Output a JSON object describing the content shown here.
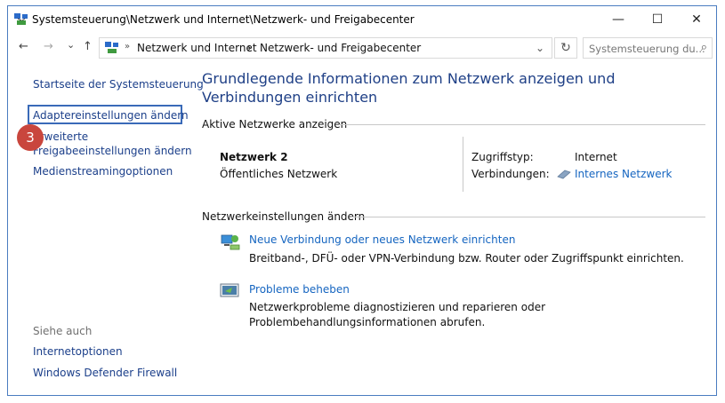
{
  "window": {
    "title": "Systemsteuerung\\Netzwerk und Internet\\Netzwerk- und Freigabecenter",
    "minimize": "—",
    "maximize": "☐",
    "close": "✕"
  },
  "address": {
    "back": "←",
    "forward": "→",
    "recent": "⌄",
    "up": "↑",
    "crumb_sep": "»",
    "crumbs": [
      "Netzwerk und Internet",
      "Netzwerk- und Freigabecenter"
    ],
    "crumb_arrow": "›",
    "dropdown": "⌄",
    "refresh": "↻",
    "search_placeholder": "Systemsteuerung du...",
    "search_icon": "⌕"
  },
  "sidebar": {
    "home": "Startseite der Systemsteuerung",
    "adapter": "Adaptereinstellungen ändern",
    "advanced_1": "Erweiterte",
    "advanced_2": "Freigabeeinstellungen ändern",
    "media": "Medienstreamingoptionen",
    "see_also": "Siehe auch",
    "internet_options": "Internetoptionen",
    "firewall": "Windows Defender Firewall"
  },
  "badge": "3",
  "main": {
    "title": "Grundlegende Informationen zum Netzwerk anzeigen und Verbindungen einrichten",
    "active_networks": "Aktive Netzwerke anzeigen",
    "network": {
      "name": "Netzwerk 2",
      "type": "Öffentliches Netzwerk",
      "access_label": "Zugriffstyp:",
      "access_value": "Internet",
      "connections_label": "Verbindungen:",
      "connections_value": "Internes Netzwerk"
    },
    "change_settings": "Netzwerkeinstellungen ändern",
    "new_connection": {
      "link": "Neue Verbindung oder neues Netzwerk einrichten",
      "desc": "Breitband-, DFÜ- oder VPN-Verbindung bzw. Router oder Zugriffspunkt einrichten."
    },
    "troubleshoot": {
      "link": "Probleme beheben",
      "desc": "Netzwerkprobleme diagnostizieren und reparieren oder Problembehandlungsinformationen abrufen."
    }
  }
}
